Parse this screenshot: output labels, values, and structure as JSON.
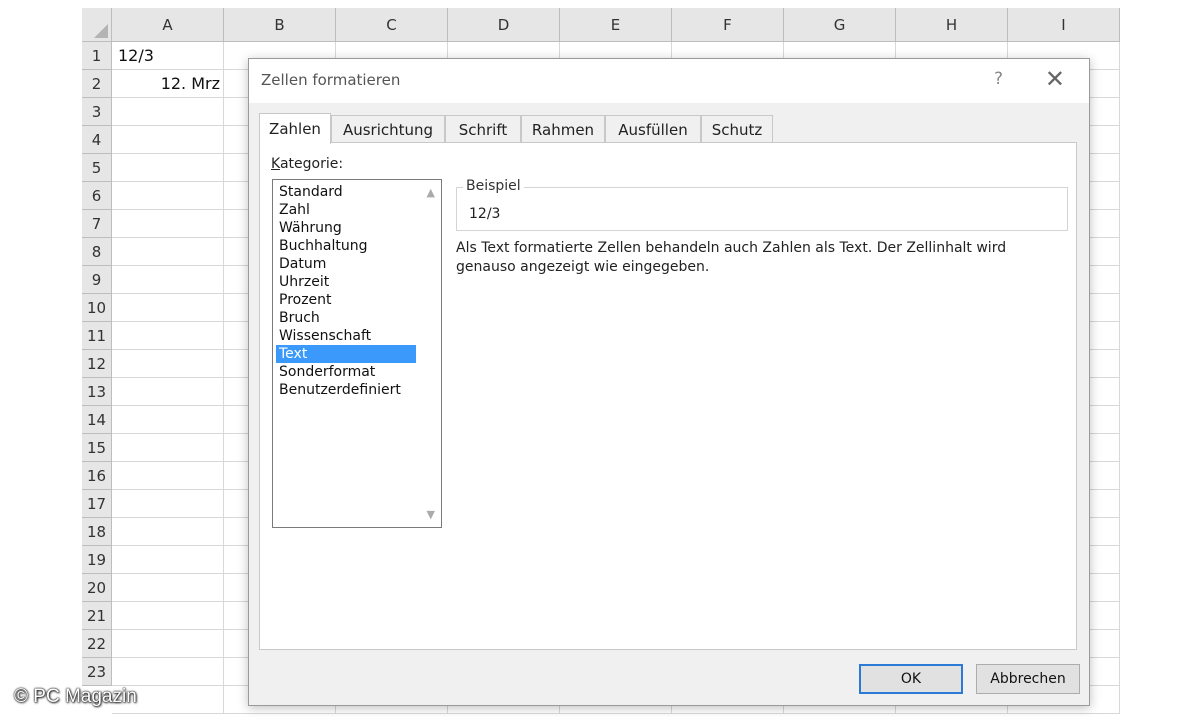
{
  "spreadsheet": {
    "columns": [
      "A",
      "B",
      "C",
      "D",
      "E",
      "F",
      "G",
      "H",
      "I"
    ],
    "rows": [
      "1",
      "2",
      "3",
      "4",
      "5",
      "6",
      "7",
      "8",
      "9",
      "10",
      "11",
      "12",
      "13",
      "14",
      "15",
      "16",
      "17",
      "18",
      "19",
      "20",
      "21",
      "22",
      "23"
    ],
    "cells": {
      "A1": "12/3",
      "A2": "12. Mrz"
    }
  },
  "dialog": {
    "title": "Zellen formatieren",
    "help_label": "?",
    "close_label": "✕",
    "tabs": [
      "Zahlen",
      "Ausrichtung",
      "Schrift",
      "Rahmen",
      "Ausfüllen",
      "Schutz"
    ],
    "active_tab": "Zahlen",
    "kategorie_label": "Kategorie:",
    "kategorie_accesskey": "K",
    "kategorie_rest": "ategorie:",
    "categories": [
      "Standard",
      "Zahl",
      "Währung",
      "Buchhaltung",
      "Datum",
      "Uhrzeit",
      "Prozent",
      "Bruch",
      "Wissenschaft",
      "Text",
      "Sonderformat",
      "Benutzerdefiniert"
    ],
    "selected_category": "Text",
    "beispiel_label": "Beispiel",
    "beispiel_value": "12/3",
    "description": "Als Text formatierte Zellen behandeln auch Zahlen als Text. Der Zellinhalt wird genauso angezeigt wie eingegeben.",
    "ok_label": "OK",
    "cancel_label": "Abbrechen"
  },
  "colors": {
    "selection": "#3b99fc",
    "ok_border": "#2b7bd6"
  },
  "watermark": "© PC Magazin"
}
